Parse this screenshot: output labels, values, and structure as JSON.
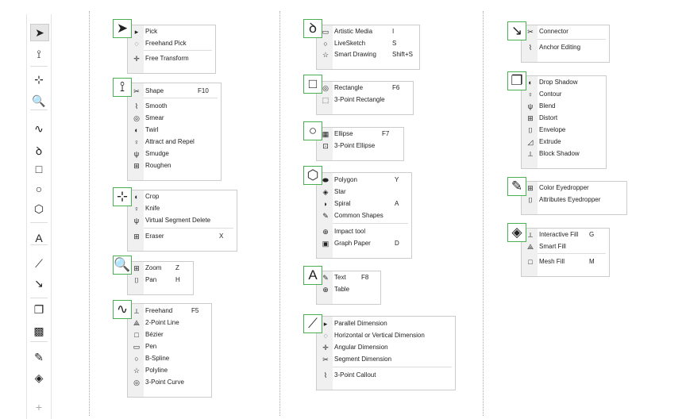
{
  "toolbar": {
    "icons": [
      "pick-icon",
      "shape-icon",
      "crop-icon",
      "zoom-icon",
      "freehand-icon",
      "artistic-media-icon",
      "rectangle-icon",
      "ellipse-icon",
      "polygon-icon",
      "text-icon",
      "dimension-icon",
      "connector-icon",
      "drop-shadow-icon",
      "transparency-icon",
      "eyedropper-icon",
      "interactive-fill-icon",
      "add-icon"
    ]
  },
  "accent": "#4caf50",
  "groups": [
    {
      "tool": "pick",
      "items": [
        {
          "label": "Pick"
        },
        {
          "label": "Freehand Pick"
        },
        {
          "label": "Free Transform",
          "sep": true
        }
      ]
    },
    {
      "tool": "shape",
      "items": [
        {
          "label": "Shape",
          "shortcut": "F10"
        },
        {
          "label": "Smooth",
          "sep": true
        },
        {
          "label": "Smear"
        },
        {
          "label": "Twirl"
        },
        {
          "label": "Attract and Repel"
        },
        {
          "label": "Smudge"
        },
        {
          "label": "Roughen"
        }
      ]
    },
    {
      "tool": "crop",
      "items": [
        {
          "label": "Crop"
        },
        {
          "label": "Knife"
        },
        {
          "label": "Virtual Segment Delete"
        },
        {
          "label": "Eraser",
          "shortcut": "X",
          "sep": true
        }
      ]
    },
    {
      "tool": "zoom",
      "items": [
        {
          "label": "Zoom",
          "shortcut": "Z"
        },
        {
          "label": "Pan",
          "shortcut": "H"
        }
      ]
    },
    {
      "tool": "freehand",
      "items": [
        {
          "label": "Freehand",
          "shortcut": "F5"
        },
        {
          "label": "2-Point Line"
        },
        {
          "label": "Bézier"
        },
        {
          "label": "Pen"
        },
        {
          "label": "B-Spline"
        },
        {
          "label": "Polyline"
        },
        {
          "label": "3-Point Curve"
        }
      ]
    },
    {
      "tool": "artistic-media",
      "items": [
        {
          "label": "Artistic Media",
          "shortcut": "I"
        },
        {
          "label": "LiveSketch",
          "shortcut": "S"
        },
        {
          "label": "Smart Drawing",
          "shortcut": "Shift+S"
        }
      ]
    },
    {
      "tool": "rectangle",
      "items": [
        {
          "label": "Rectangle",
          "shortcut": "F6"
        },
        {
          "label": "3-Point Rectangle"
        }
      ]
    },
    {
      "tool": "ellipse",
      "items": [
        {
          "label": "Ellipse",
          "shortcut": "F7"
        },
        {
          "label": "3-Point Ellipse"
        }
      ]
    },
    {
      "tool": "polygon",
      "items": [
        {
          "label": "Polygon",
          "shortcut": "Y"
        },
        {
          "label": "Star"
        },
        {
          "label": "Spiral",
          "shortcut": "A"
        },
        {
          "label": "Common Shapes"
        },
        {
          "label": "Impact tool",
          "sep": true
        },
        {
          "label": "Graph Paper",
          "shortcut": "D"
        }
      ]
    },
    {
      "tool": "text",
      "items": [
        {
          "label": "Text",
          "shortcut": "F8"
        },
        {
          "label": "Table"
        }
      ]
    },
    {
      "tool": "dimension",
      "items": [
        {
          "label": "Parallel Dimension"
        },
        {
          "label": "Horizontal or Vertical Dimension"
        },
        {
          "label": "Angular Dimension"
        },
        {
          "label": "Segment Dimension"
        },
        {
          "label": "3-Point Callout",
          "sep": true
        }
      ]
    },
    {
      "tool": "connector",
      "items": [
        {
          "label": "Connector"
        },
        {
          "label": "Anchor Editing",
          "sep": true
        }
      ]
    },
    {
      "tool": "drop-shadow",
      "items": [
        {
          "label": "Drop Shadow"
        },
        {
          "label": "Contour"
        },
        {
          "label": "Blend"
        },
        {
          "label": "Distort"
        },
        {
          "label": "Envelope"
        },
        {
          "label": "Extrude"
        },
        {
          "label": "Block Shadow"
        }
      ]
    },
    {
      "tool": "eyedropper",
      "items": [
        {
          "label": "Color Eyedropper"
        },
        {
          "label": "Attributes Eyedropper"
        }
      ]
    },
    {
      "tool": "interactive-fill",
      "items": [
        {
          "label": "Interactive Fill",
          "shortcut": "G"
        },
        {
          "label": "Smart Fill"
        },
        {
          "label": "Mesh Fill",
          "shortcut": "M",
          "sep": true
        }
      ]
    }
  ]
}
